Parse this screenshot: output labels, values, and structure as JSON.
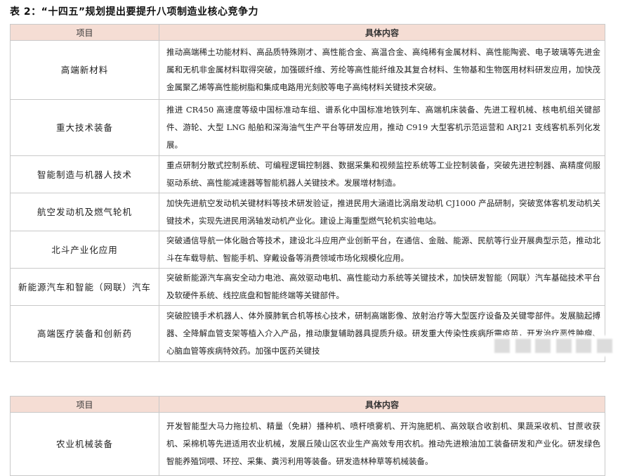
{
  "caption": "表 2：“十四五”规划提出要提升八项制造业核心竞争力",
  "table1": {
    "headers": [
      "项目",
      "具体内容"
    ],
    "rows": [
      {
        "cat": "高端新材料",
        "desc": "推动高端稀土功能材料、高品质特殊刚才、高性能合金、高温合金、高纯稀有金属材料、高性能陶瓷、电子玻璃等先进金属和无机非金属材料取得突破，加强碳纤维、芳纶等高性能纤维及其复合材料、生物基和生物医用材料研发应用，加快茂金属聚乙烯等高性能树脂和集成电路用光刻胶等电子高纯材料关键技术突破。"
      },
      {
        "cat": "重大技术装备",
        "desc": "推进 CR450 高速度等级中国标准动车组、谱系化中国标准地铁列车、高端机床装备、先进工程机械、核电机组关键部件、游轮、大型 LNG 船舶和深海油气生产平台等研发应用，推动 C919 大型客机示范运营和 ARJ21 支线客机系列化发展。"
      },
      {
        "cat": "智能制造与机器人技术",
        "desc": "重点研制分散式控制系统、可编程逻辑控制器、数据采集和视频监控系统等工业控制装备，突破先进控制器、高精度伺服驱动系统、高性能减速器等智能机器人关键技术。发展增材制造。"
      },
      {
        "cat": "航空发动机及燃气轮机",
        "desc": "加快先进航空发动机关键材料等技术研发验证，推进民用大涵道比涡扇发动机 CJ1000 产品研制，突破宽体客机发动机关键技术，实现先进民用涡轴发动机产业化。建设上海重型燃气轮机实验电站。"
      },
      {
        "cat": "北斗产业化应用",
        "desc": "突破通信导航一体化融合等技术，建设北斗应用产业创新平台，在通信、金融、能源、民航等行业开展典型示范，推动北斗在车载导航、智能手机、穿戴设备等消费领域市场化规模化应用。"
      },
      {
        "cat": "新能源汽车和智能（网联）汽车",
        "desc": "突破新能源汽车高安全动力电池、高效驱动电机、高性能动力系统等关键技术，加快研发智能（网联）汽车基础技术平台及软硬件系统、线控底盘和智能终端等关键部件。"
      },
      {
        "cat": "高端医疗装备和创新药",
        "desc": "突破腔镜手术机器人、体外膜肺氧合机等核心技术，研制高端影像、放射治疗等大型医疗设备及关键零部件。发展脑起搏器、全降解血管支架等植入介入产品，推动康复辅助器具提质升级。研发重大传染性疾病所需疫苗，开发治疗恶性肿瘤、心脑血管等疾病特效药。加强中医药关键技"
      }
    ]
  },
  "table2": {
    "headers": [
      "项目",
      "具体内容"
    ],
    "rows": [
      {
        "cat": "农业机械装备",
        "desc": "开发智能型大马力拖拉机、精量（免耕）播种机、喷杆喷雾机、开沟施肥机、高效联合收割机、果蔬采收机、甘蔗收获机、采棉机等先进适用农业机械，发展丘陵山区农业生产高效专用农机。推动先进粮油加工装备研发和产业化。研发绿色智能养殖饲喂、环控、采集、粪污利用等装备。研发造林种草等机械装备。"
      }
    ]
  }
}
